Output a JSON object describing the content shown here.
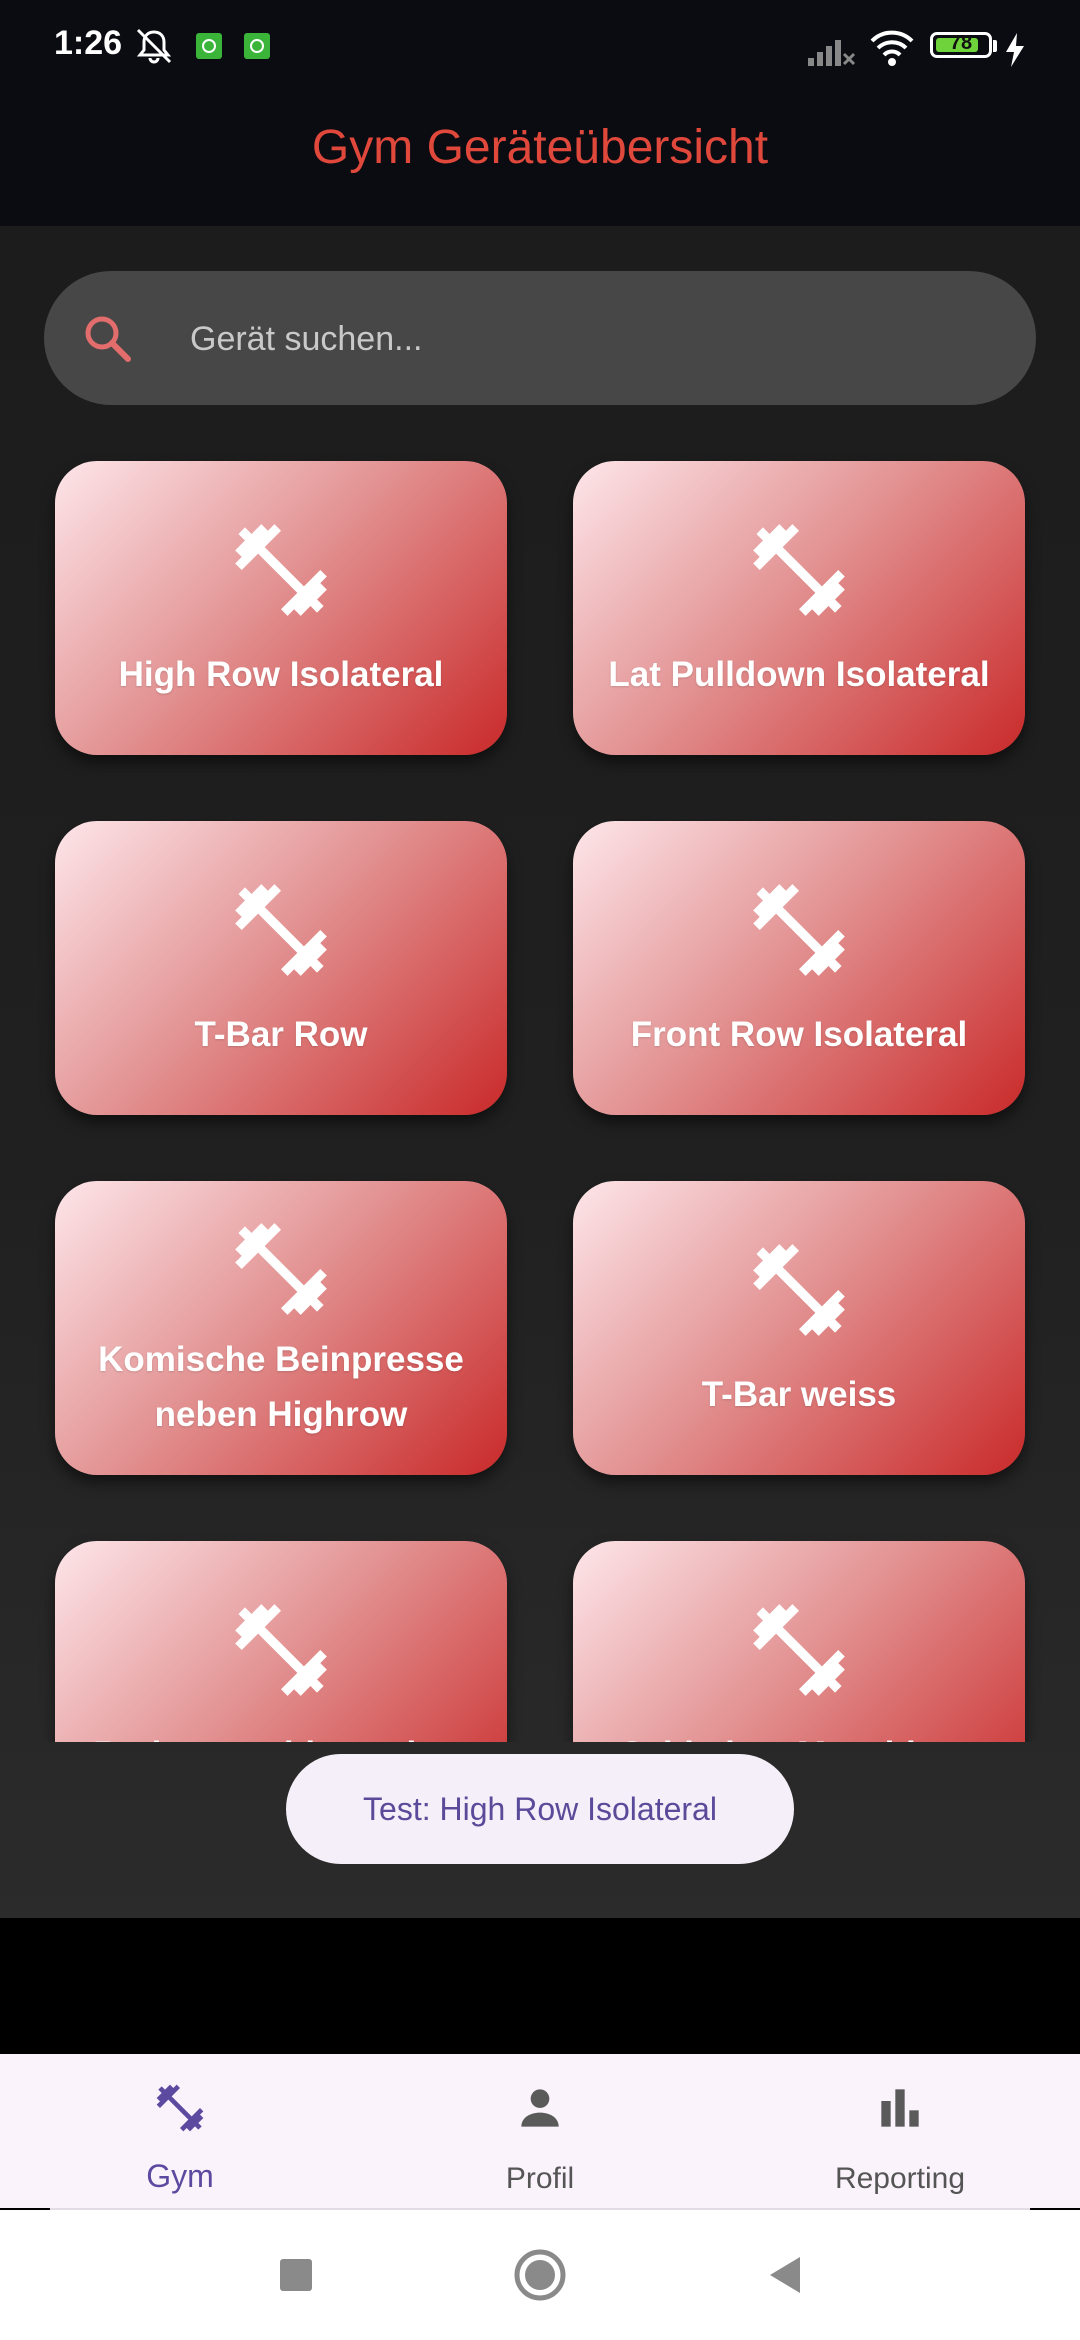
{
  "status_bar": {
    "time": "1:26",
    "battery": "78"
  },
  "app_title": "Gym Geräteübersicht",
  "search": {
    "placeholder": "Gerät suchen..."
  },
  "devices": [
    {
      "label": "High Row Isolateral"
    },
    {
      "label": "Lat Pulldown Isolateral"
    },
    {
      "label": "T-Bar Row"
    },
    {
      "label": "Front Row Isolateral"
    },
    {
      "label": "Komische Beinpresse neben Highrow"
    },
    {
      "label": "T-Bar weiss"
    },
    {
      "label": "Rudermaschine neben"
    },
    {
      "label": "Seitheben Maschinne"
    }
  ],
  "toast": "Test: High Row Isolateral",
  "nav": {
    "items": [
      {
        "label": "Gym",
        "icon": "dumbbell-icon",
        "active": true
      },
      {
        "label": "Profil",
        "icon": "person-icon",
        "active": false
      },
      {
        "label": "Reporting",
        "icon": "bar-chart-icon",
        "active": false
      }
    ]
  },
  "colors": {
    "accent_title": "#e0483b",
    "card_gradient_start": "#fde6ea",
    "card_gradient_end": "#c92a2a",
    "nav_active": "#5b4aa0"
  }
}
